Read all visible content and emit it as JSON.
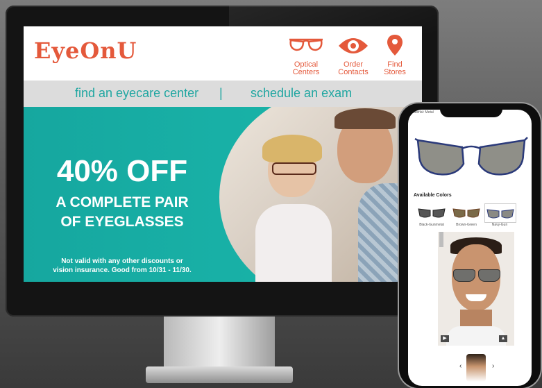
{
  "site": {
    "logo": "EyeOnU",
    "nav": [
      {
        "label_line1": "Optical",
        "label_line2": "Centers",
        "icon": "glasses-icon"
      },
      {
        "label_line1": "Order",
        "label_line2": "Contacts",
        "icon": "eye-icon"
      },
      {
        "label_line1": "Find",
        "label_line2": "Stores",
        "icon": "location-pin-icon"
      }
    ],
    "subnav": {
      "left": "find an eyecare center",
      "separator": "|",
      "right": "schedule an exam"
    },
    "hero": {
      "headline": "40% OFF",
      "line1": "A COMPLETE PAIR",
      "line2": "OF EYEGLASSES",
      "fine_print_1": "Not valid with any other discounts or",
      "fine_print_2": "vision insurance. Good from 10/31 - 11/30."
    }
  },
  "phone": {
    "material_label": "Material: Metal",
    "colors_title": "Available Colors",
    "swatches": [
      {
        "label": "Black-Gunmetal"
      },
      {
        "label": "Brown-Green"
      },
      {
        "label": "Navy-Gun"
      }
    ],
    "carousel_prev": "‹",
    "carousel_next": "›"
  },
  "colors": {
    "brand": "#e4593b",
    "teal": "#1fa6a1"
  }
}
